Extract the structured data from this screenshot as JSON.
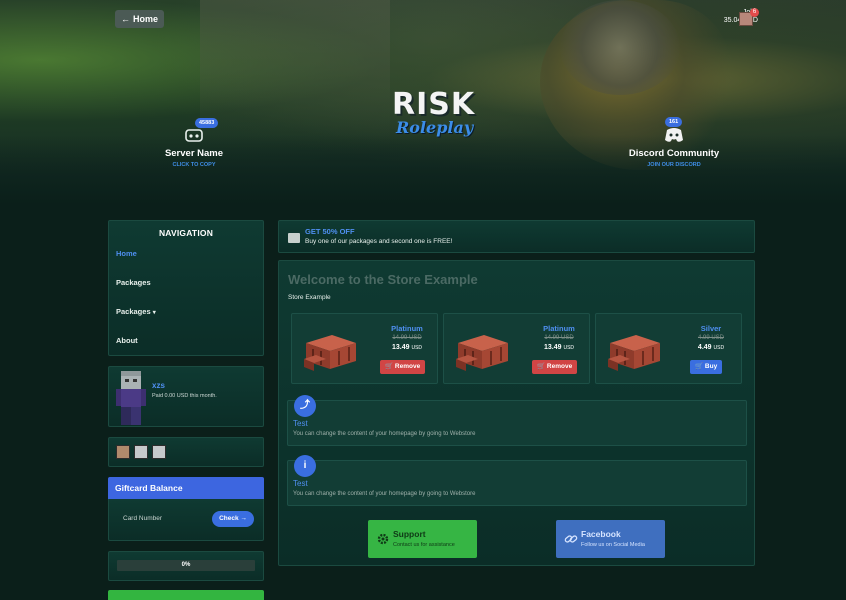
{
  "header": {
    "home_label": "Home",
    "user": {
      "name": "John",
      "balance": "35.04 USD",
      "notifications": "6"
    },
    "logo": {
      "line1": "RISK",
      "line2": "Roleplay"
    },
    "server": {
      "count": "45883",
      "title": "Server Name",
      "action": "CLICK TO COPY"
    },
    "discord": {
      "count": "161",
      "title": "Discord Community",
      "action": "JOIN OUR DISCORD"
    }
  },
  "sidebar": {
    "nav_title": "NAVIGATION",
    "nav_items": [
      {
        "label": "Home",
        "active": true
      },
      {
        "label": "Packages"
      },
      {
        "label": "Packages",
        "dropdown": true
      },
      {
        "label": "About"
      }
    ],
    "profile": {
      "name": "xzs",
      "paid": "Paid 0.00 USD this month."
    },
    "giftcard": {
      "title": "Giftcard Balance",
      "placeholder": "Card Number",
      "button": "Check"
    },
    "goal": {
      "text": "0%",
      "progress": 0
    }
  },
  "promo": {
    "title": "GET 50% OFF",
    "subtitle": "Buy one of our packages and second one is FREE!"
  },
  "main": {
    "title": "Welcome to the Store Example",
    "subtitle": "Store Example",
    "packages": [
      {
        "name": "Platinum",
        "old_price": "14.99 USD",
        "price": "13.49",
        "currency": "USD",
        "button": "Remove"
      },
      {
        "name": "Platinum",
        "old_price": "14.99 USD",
        "price": "13.49",
        "currency": "USD",
        "button": "Remove"
      },
      {
        "name": "Silver",
        "old_price": "4.99 USD",
        "price": "4.49",
        "currency": "USD",
        "button": "Buy"
      }
    ],
    "info_blocks": [
      {
        "title": "Test",
        "text": "You can change the content of your homepage by going to Webstore",
        "icon": "run-icon"
      },
      {
        "title": "Test",
        "text": "You can change the content of your homepage by going to Webstore",
        "icon": "info-icon"
      }
    ],
    "support": {
      "title": "Support",
      "subtitle": "Contact us for assistance"
    },
    "facebook": {
      "title": "Facebook",
      "subtitle": "Follow us on Social Media"
    }
  },
  "colors": {
    "accent": "#3a6ee0",
    "link": "#4f8ff0",
    "remove": "#d14545",
    "support": "#36b544",
    "facebook": "#3f6fbf",
    "panel": "#0f3a32"
  }
}
